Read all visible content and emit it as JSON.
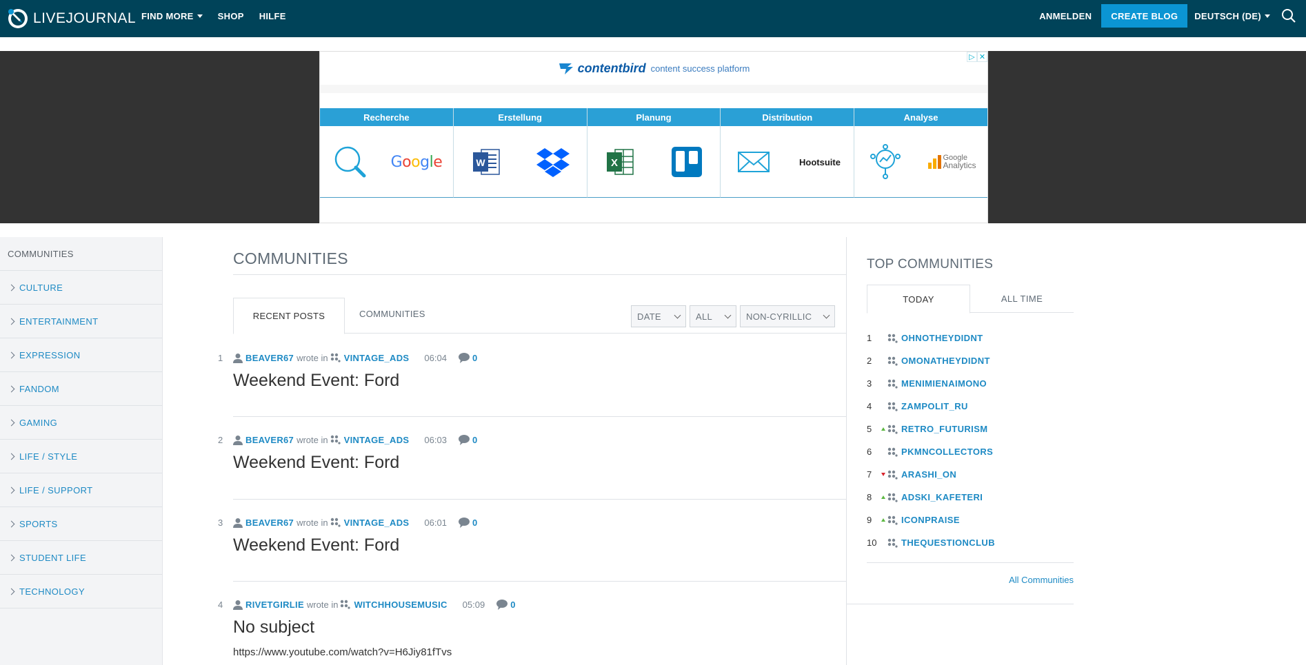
{
  "header": {
    "logo_text": "LIVEJOURNAL",
    "nav": [
      {
        "label": "FIND MORE",
        "has_caret": true
      },
      {
        "label": "SHOP",
        "has_caret": false
      },
      {
        "label": "HILFE",
        "has_caret": false
      }
    ],
    "login_label": "ANMELDEN",
    "create_blog_label": "CREATE BLOG",
    "language_label": "DEUTSCH (DE)",
    "search_icon": "search-icon"
  },
  "ad": {
    "brand": "contentbird",
    "tagline": "content success platform",
    "columns": [
      {
        "heading": "Recherche",
        "icons": [
          "magnifier-icon",
          "google-logo"
        ]
      },
      {
        "heading": "Erstellung",
        "icons": [
          "word-icon",
          "dropbox-icon"
        ]
      },
      {
        "heading": "Planung",
        "icons": [
          "excel-icon",
          "trello-icon"
        ]
      },
      {
        "heading": "Distribution",
        "icons": [
          "mail-icon",
          "hootsuite-logo"
        ]
      },
      {
        "heading": "Analyse",
        "icons": [
          "analytics-icon",
          "google-analytics-logo"
        ]
      }
    ],
    "google_word": "Google",
    "hootsuite_word": "Hootsuite",
    "ga_word_top": "Google",
    "ga_word_bottom": "Analytics"
  },
  "sidebar": {
    "heading": "COMMUNITIES",
    "items": [
      "CULTURE",
      "ENTERTAINMENT",
      "EXPRESSION",
      "FANDOM",
      "GAMING",
      "LIFE / STYLE",
      "LIFE / SUPPORT",
      "SPORTS",
      "STUDENT LIFE",
      "TECHNOLOGY"
    ]
  },
  "main": {
    "title": "COMMUNITIES",
    "tabs": {
      "active": "RECENT POSTS",
      "other": "COMMUNITIES"
    },
    "filters": [
      "DATE",
      "ALL",
      "NON-CYRILLIC"
    ],
    "posts": [
      {
        "num": "1",
        "user": "BEAVER67",
        "wrote_in": "wrote in",
        "community": "VINTAGE_ADS",
        "time": "06:04",
        "comments": "0",
        "title": "Weekend Event: Ford",
        "url": ""
      },
      {
        "num": "2",
        "user": "BEAVER67",
        "wrote_in": "wrote in",
        "community": "VINTAGE_ADS",
        "time": "06:03",
        "comments": "0",
        "title": "Weekend Event: Ford",
        "url": ""
      },
      {
        "num": "3",
        "user": "BEAVER67",
        "wrote_in": "wrote in",
        "community": "VINTAGE_ADS",
        "time": "06:01",
        "comments": "0",
        "title": "Weekend Event: Ford",
        "url": ""
      },
      {
        "num": "4",
        "user": "RIVETGIRLIE",
        "wrote_in": "wrote in",
        "community": "WITCHHOUSEMUSIC",
        "time": "05:09",
        "comments": "0",
        "title": "No subject",
        "url": "https://www.youtube.com/watch?v=H6Jiy81fTvs"
      }
    ]
  },
  "top_communities": {
    "title": "TOP COMMUNITIES",
    "tabs": {
      "active": "TODAY",
      "other": "ALL TIME"
    },
    "list": [
      {
        "rank": "1",
        "trend": "none",
        "name": "OHNOTHEYDIDNT"
      },
      {
        "rank": "2",
        "trend": "none",
        "name": "OMONATHEYDIDNT"
      },
      {
        "rank": "3",
        "trend": "none",
        "name": "MENIMIENAIMONO"
      },
      {
        "rank": "4",
        "trend": "none",
        "name": "ZAMPOLIT_RU"
      },
      {
        "rank": "5",
        "trend": "up",
        "name": "RETRO_FUTURISM"
      },
      {
        "rank": "6",
        "trend": "none",
        "name": "PKMNCOLLECTORS"
      },
      {
        "rank": "7",
        "trend": "down",
        "name": "ARASHI_ON"
      },
      {
        "rank": "8",
        "trend": "up",
        "name": "ADSKI_KAFETERI"
      },
      {
        "rank": "9",
        "trend": "up",
        "name": "ICONPRAISE"
      },
      {
        "rank": "10",
        "trend": "none",
        "name": "THEQUESTIONCLUB"
      }
    ],
    "all_link": "All Communities"
  },
  "colors": {
    "header_bg": "#004359",
    "accent": "#0b95d3",
    "link": "#1e8ac4",
    "trend_up": "#5db843",
    "trend_down": "#d8262f"
  }
}
